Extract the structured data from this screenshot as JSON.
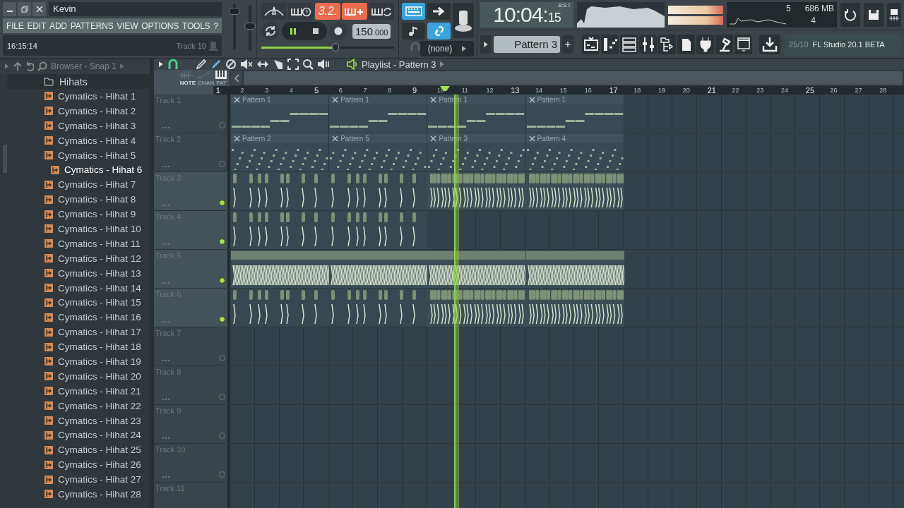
{
  "window": {
    "title": "Kevin"
  },
  "menu": [
    "FILE",
    "EDIT",
    "ADD",
    "PATTERNS",
    "VIEW",
    "OPTIONS",
    "TOOLS",
    "?"
  ],
  "hint_panel": {
    "time": "16:15:14",
    "text": "Track 10"
  },
  "mixer_sliders": [
    {
      "kind": "volume",
      "level": 0.85
    },
    {
      "kind": "pitch",
      "level": 0.55
    }
  ],
  "record_buttons": [
    {
      "kind": "metronome",
      "on": false
    },
    {
      "kind": "wait",
      "on": false
    },
    {
      "kind": "countdown",
      "on": true,
      "label": "3.2."
    },
    {
      "kind": "blend",
      "on": true
    },
    {
      "kind": "loop",
      "on": false
    }
  ],
  "transport": {
    "playing": true,
    "recording": false,
    "tempo": "150",
    "tempo_fraction": ".000",
    "position": {
      "level": 0.56
    }
  },
  "tools": [
    {
      "kind": "keyboard",
      "on": true
    },
    {
      "kind": "arrow",
      "on": false
    },
    {
      "kind": "note",
      "on": false
    },
    {
      "kind": "link",
      "on": true
    }
  ],
  "snap": {
    "value": "(none)"
  },
  "clock": {
    "main": "10:04:",
    "seconds": "15",
    "format": "B:S:T"
  },
  "cpu": {
    "value": "5",
    "memory": "686 MB",
    "polyphony": "4"
  },
  "pattern_picker": {
    "name": "Pattern 3",
    "add": "+"
  },
  "hint_bar": {
    "counter": "25/10",
    "text": "FL Studio 20.1 BETA"
  },
  "browser": {
    "title": "Browser - Snap 1",
    "folder": "Hihats",
    "items": [
      {
        "label": "Cymatics - Hihat 1",
        "selected": false
      },
      {
        "label": "Cymatics - Hihat 2",
        "selected": false
      },
      {
        "label": "Cymatics - Hihat 3",
        "selected": false
      },
      {
        "label": "Cymatics - Hihat 4",
        "selected": false
      },
      {
        "label": "Cymatics - Hihat 5",
        "selected": false
      },
      {
        "label": "Cymatics - Hihat 6",
        "selected": true
      },
      {
        "label": "Cymatics - Hihat 7",
        "selected": false
      },
      {
        "label": "Cymatics - Hihat 8",
        "selected": false
      },
      {
        "label": "Cymatics - Hihat 9",
        "selected": false
      },
      {
        "label": "Cymatics - Hihat 10",
        "selected": false
      },
      {
        "label": "Cymatics - Hihat 11",
        "selected": false
      },
      {
        "label": "Cymatics - Hihat 12",
        "selected": false
      },
      {
        "label": "Cymatics - Hihat 13",
        "selected": false
      },
      {
        "label": "Cymatics - Hihat 14",
        "selected": false
      },
      {
        "label": "Cymatics - Hihat 15",
        "selected": false
      },
      {
        "label": "Cymatics - Hihat 16",
        "selected": false
      },
      {
        "label": "Cymatics - Hihat 17",
        "selected": false
      },
      {
        "label": "Cymatics - Hihat 18",
        "selected": false
      },
      {
        "label": "Cymatics - Hihat 19",
        "selected": false
      },
      {
        "label": "Cymatics - Hihat 20",
        "selected": false
      },
      {
        "label": "Cymatics - Hihat 21",
        "selected": false
      },
      {
        "label": "Cymatics - Hihat 22",
        "selected": false
      },
      {
        "label": "Cymatics - Hihat 23",
        "selected": false
      },
      {
        "label": "Cymatics - Hihat 24",
        "selected": false
      },
      {
        "label": "Cymatics - Hihat 25",
        "selected": false
      },
      {
        "label": "Cymatics - Hihat 26",
        "selected": false
      },
      {
        "label": "Cymatics - Hihat 27",
        "selected": false
      },
      {
        "label": "Cymatics - Hihat 28",
        "selected": false
      }
    ]
  },
  "playlist": {
    "title": "Playlist - Pattern 3",
    "modes": [
      {
        "label": "NOTE",
        "selected": true
      },
      {
        "label": "CHAN",
        "selected": false
      },
      {
        "label": "PAT",
        "selected": false
      }
    ],
    "ruler": [
      "1",
      "2",
      "3",
      "4",
      "5",
      "6",
      "7",
      "8",
      "9",
      "10",
      "11",
      "12",
      "13",
      "14",
      "15",
      "16",
      "17",
      "18",
      "19",
      "20",
      "21",
      "22",
      "23",
      "24",
      "25",
      "26",
      "27",
      "28"
    ],
    "playhead": {
      "level": 0.336
    },
    "tracks": [
      {
        "name": "Track 1",
        "active": false,
        "clips": [
          {
            "kind": "pattern",
            "label": "Pattern 1"
          },
          {
            "kind": "pattern",
            "label": "Pattern 1"
          },
          {
            "kind": "pattern",
            "label": "Pattern 1"
          },
          {
            "kind": "pattern",
            "label": "Pattern 1"
          }
        ]
      },
      {
        "name": "Track 2",
        "active": false,
        "clips": [
          {
            "kind": "pattern",
            "label": "Pattern 2"
          },
          {
            "kind": "pattern",
            "label": "Pattern 5"
          },
          {
            "kind": "pattern",
            "label": "Pattern 3"
          },
          {
            "kind": "pattern",
            "label": "Pattern 4"
          }
        ]
      },
      {
        "name": "Track 3",
        "active": true,
        "clips": [
          {
            "kind": "audio",
            "dense": false
          },
          {
            "kind": "audio",
            "dense": false
          },
          {
            "kind": "audio",
            "dense": true
          },
          {
            "kind": "audio",
            "dense": true
          }
        ]
      },
      {
        "name": "Track 4",
        "active": true,
        "clips": [
          {
            "kind": "audio",
            "dense": false
          },
          {
            "kind": "audio",
            "dense": false
          }
        ]
      },
      {
        "name": "Track 5",
        "active": true,
        "clips": [
          {
            "kind": "audio",
            "dense": true
          },
          {
            "kind": "audio",
            "dense": true
          },
          {
            "kind": "audio",
            "dense": true
          },
          {
            "kind": "audio",
            "dense": true
          }
        ]
      },
      {
        "name": "Track 6",
        "active": true,
        "clips": [
          {
            "kind": "audio",
            "dense": false
          },
          {
            "kind": "audio",
            "dense": false
          },
          {
            "kind": "audio",
            "dense": true
          },
          {
            "kind": "audio",
            "dense": true
          }
        ]
      },
      {
        "name": "Track 7",
        "active": false
      },
      {
        "name": "Track 8",
        "active": false
      },
      {
        "name": "Track 9",
        "active": false
      },
      {
        "name": "Track 10",
        "active": false
      },
      {
        "name": "Track 11"
      }
    ]
  }
}
